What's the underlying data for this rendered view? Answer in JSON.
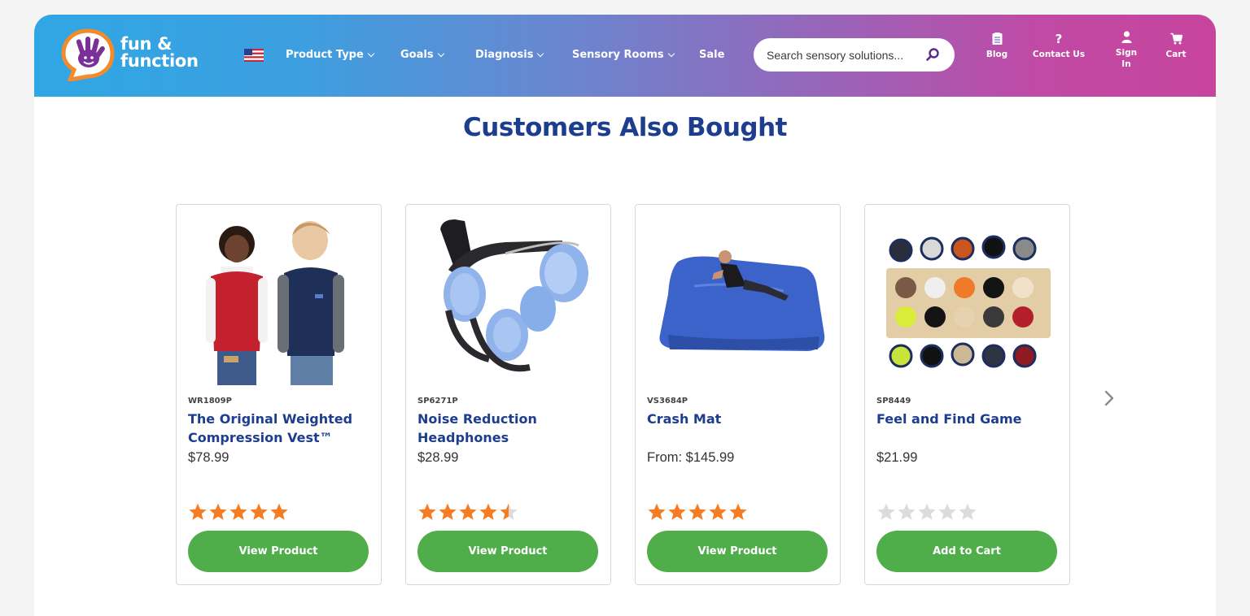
{
  "header": {
    "logo_line1": "fun &",
    "logo_line2": "function",
    "nav": [
      {
        "label": "Product Type"
      },
      {
        "label": "Goals"
      },
      {
        "label": "Diagnosis"
      },
      {
        "label": "Sensory Rooms"
      },
      {
        "label": "Sale"
      }
    ],
    "search_placeholder": "Search sensory solutions...",
    "utility": {
      "blog": "Blog",
      "contact": "Contact Us",
      "sign_in_line1": "Sign",
      "sign_in_line2": "In",
      "cart": "Cart"
    }
  },
  "section_title": "Customers Also Bought",
  "products": [
    {
      "sku": "WR1809P",
      "name": "The Original Weighted Compression Vest™",
      "price": "$78.99",
      "rating": 5,
      "button": "View Product"
    },
    {
      "sku": "SP6271P",
      "name": "Noise Reduction Headphones",
      "price": "$28.99",
      "rating": 4.5,
      "button": "View Product"
    },
    {
      "sku": "VS3684P",
      "name": "Crash Mat",
      "price": "From: $145.99",
      "rating": 5,
      "button": "View Product"
    },
    {
      "sku": "SP8449",
      "name": "Feel and Find Game",
      "price": "$21.99",
      "rating": 0,
      "button": "Add to Cart"
    }
  ],
  "colors": {
    "title": "#1d3d8f",
    "button": "#4fae4a",
    "star_on": "#f57c22",
    "star_off": "#dcdcdc"
  }
}
